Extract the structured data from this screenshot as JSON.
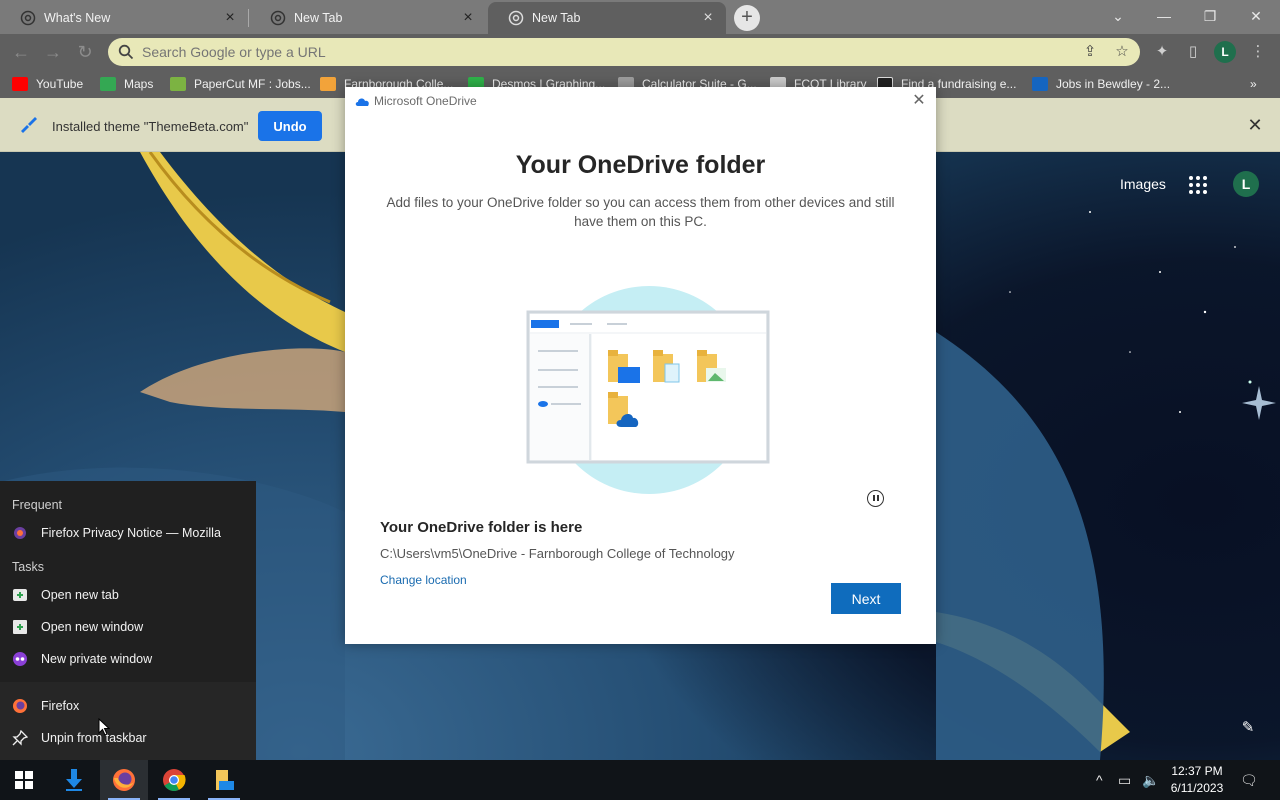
{
  "browser": {
    "tabs": [
      {
        "title": "What's New"
      },
      {
        "title": "New Tab"
      },
      {
        "title": "New Tab"
      }
    ],
    "omnibox_placeholder": "Search Google or type a URL",
    "profile_initial": "L",
    "bookmarks": [
      {
        "label": "YouTube",
        "color": "#ff0000"
      },
      {
        "label": "Maps",
        "color": "#34a853"
      },
      {
        "label": "PaperCut MF : Jobs...",
        "color": "#7cb342"
      },
      {
        "label": "Farnborough Colle...",
        "color": "#f2a33a"
      },
      {
        "label": "Desmos | Graphing...",
        "color": "#2fb34a"
      },
      {
        "label": "Calculator Suite - G...",
        "color": "#9e9e9e"
      },
      {
        "label": "FCOT Library",
        "color": "#cccccc"
      },
      {
        "label": "Find a fundraising e...",
        "color": "#222222"
      },
      {
        "label": "Jobs in Bewdley - 2...",
        "color": "#1565c0"
      }
    ],
    "infobar": {
      "message": "Installed theme \"ThemeBeta.com\"",
      "undo_label": "Undo"
    }
  },
  "ntp": {
    "images_link": "Images",
    "profile_initial": "L"
  },
  "onedrive_dialog": {
    "window_title": "Microsoft OneDrive",
    "heading": "Your OneDrive folder",
    "description": "Add files to your OneDrive folder so you can access them from other devices and still have them on this PC.",
    "subheading": "Your OneDrive folder is here",
    "path": "C:\\Users\\vm5\\OneDrive - Farnborough College of Technology",
    "change_location": "Change location",
    "next_label": "Next"
  },
  "jumplist": {
    "frequent_header": "Frequent",
    "frequent": [
      "Firefox Privacy Notice — Mozilla"
    ],
    "tasks_header": "Tasks",
    "tasks": [
      "Open new tab",
      "Open new window",
      "New private window"
    ],
    "app": "Firefox",
    "unpin": "Unpin from taskbar"
  },
  "taskbar": {
    "time": "12:37 PM",
    "date": "6/11/2023"
  },
  "colors": {
    "accent_blue": "#1a73e8",
    "onedrive_blue": "#0f6cbd",
    "infobar": "#dcdcc2",
    "omnibox": "#e8e8b8"
  }
}
